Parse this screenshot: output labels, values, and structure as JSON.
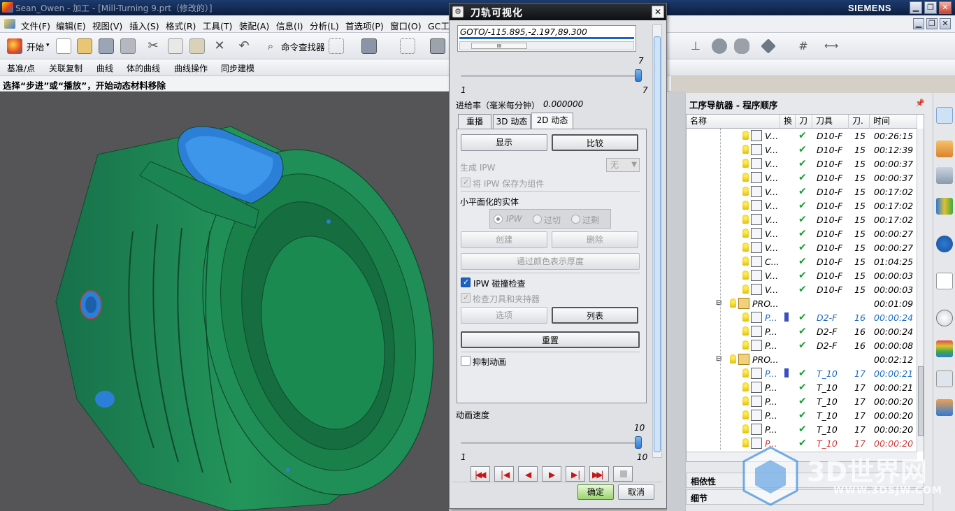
{
  "window": {
    "title": "Sean_Owen - 加工 - [Mill-Turning 9.prt（修改的）]",
    "brand": "SIEMENS"
  },
  "menu": [
    "文件(F)",
    "编辑(E)",
    "视图(V)",
    "插入(S)",
    "格式(R)",
    "工具(T)",
    "装配(A)",
    "信息(I)",
    "分析(L)",
    "首选项(P)",
    "窗口(O)",
    "GC工"
  ],
  "toolbar1": {
    "start_label": "开始",
    "command_finder_label": "命令查找器"
  },
  "toolbar2": [
    "基准/点",
    "关联复制",
    "曲线",
    "体的曲线",
    "曲线操作",
    "同步建模"
  ],
  "status": "选择“步进”或“播放”，开始动态材料移除",
  "dialog": {
    "title": "刀轨可视化",
    "goto": "GOTO/-115.895,-2.197,89.300",
    "scroll_mark": "III",
    "slider1_top": "7",
    "slider1_min": "1",
    "slider1_max": "7",
    "feed_label": "进给率（毫米每分钟）",
    "feed_value": "0.000000",
    "tabs": [
      "重播",
      "3D 动态",
      "2D 动态"
    ],
    "active_tab": 2,
    "display_btn": "显示",
    "compare_btn": "比较",
    "generate_ipw": "生成 IPW",
    "generate_value": "无",
    "save_ipw": "将 IPW 保存为组件",
    "faceted_label": "小平面化的实体",
    "radios": [
      "IPW",
      "过切",
      "过剩"
    ],
    "create_btn": "创建",
    "delete_btn": "删除",
    "thickness_btn": "通过颜色表示厚度",
    "ipw_check": "IPW 碰撞检查",
    "holder_check": "检查刀具和夹持器",
    "options_btn": "选项",
    "list_btn": "列表",
    "reset_btn": "重置",
    "suppress": "抑制动画",
    "speed_label": "动画速度",
    "speed_top": "10",
    "speed_min": "1",
    "speed_max": "10",
    "ok": "确定",
    "cancel": "取消"
  },
  "navigator": {
    "title": "工序导航器 - 程序顺序",
    "columns": [
      "名称",
      "换",
      "刀",
      "刀具",
      "刀.",
      "时间"
    ],
    "rows": [
      {
        "name": "V...",
        "tool": "D10-F",
        "num": "15",
        "time": "00:26:15",
        "style": ""
      },
      {
        "name": "V...",
        "tool": "D10-F",
        "num": "15",
        "time": "00:12:39",
        "style": ""
      },
      {
        "name": "V...",
        "tool": "D10-F",
        "num": "15",
        "time": "00:00:37",
        "style": ""
      },
      {
        "name": "V...",
        "tool": "D10-F",
        "num": "15",
        "time": "00:00:37",
        "style": ""
      },
      {
        "name": "V...",
        "tool": "D10-F",
        "num": "15",
        "time": "00:17:02",
        "style": ""
      },
      {
        "name": "V...",
        "tool": "D10-F",
        "num": "15",
        "time": "00:17:02",
        "style": ""
      },
      {
        "name": "V...",
        "tool": "D10-F",
        "num": "15",
        "time": "00:17:02",
        "style": ""
      },
      {
        "name": "V...",
        "tool": "D10-F",
        "num": "15",
        "time": "00:00:27",
        "style": ""
      },
      {
        "name": "V...",
        "tool": "D10-F",
        "num": "15",
        "time": "00:00:27",
        "style": ""
      },
      {
        "name": "C...",
        "tool": "D10-F",
        "num": "15",
        "time": "01:04:25",
        "style": ""
      },
      {
        "name": "V...",
        "tool": "D10-F",
        "num": "15",
        "time": "00:00:03",
        "style": ""
      },
      {
        "name": "V...",
        "tool": "D10-F",
        "num": "15",
        "time": "00:00:03",
        "style": ""
      },
      {
        "name": "PRO...",
        "tool": "",
        "num": "",
        "time": "00:01:09",
        "style": "group"
      },
      {
        "name": "P...",
        "tool": "D2-F",
        "num": "16",
        "time": "00:00:24",
        "style": "blue"
      },
      {
        "name": "P...",
        "tool": "D2-F",
        "num": "16",
        "time": "00:00:24",
        "style": ""
      },
      {
        "name": "P...",
        "tool": "D2-F",
        "num": "16",
        "time": "00:00:08",
        "style": ""
      },
      {
        "name": "PRO...",
        "tool": "",
        "num": "",
        "time": "00:02:12",
        "style": "group"
      },
      {
        "name": "P...",
        "tool": "T_10",
        "num": "17",
        "time": "00:00:21",
        "style": "blue"
      },
      {
        "name": "P...",
        "tool": "T_10",
        "num": "17",
        "time": "00:00:21",
        "style": ""
      },
      {
        "name": "P...",
        "tool": "T_10",
        "num": "17",
        "time": "00:00:20",
        "style": ""
      },
      {
        "name": "P...",
        "tool": "T_10",
        "num": "17",
        "time": "00:00:20",
        "style": ""
      },
      {
        "name": "P...",
        "tool": "T_10",
        "num": "17",
        "time": "00:00:20",
        "style": ""
      },
      {
        "name": "P...",
        "tool": "T_10",
        "num": "17",
        "time": "00:00:20",
        "style": "red"
      }
    ],
    "dependency": "相依性",
    "details": "细节"
  },
  "watermark": {
    "brand": "3D世界网",
    "url": "WWW.3DSJW.COM"
  },
  "colors": {
    "part_green": "#1f8c52",
    "part_blue": "#2b7fd6",
    "viewport_bg": "#555558"
  }
}
